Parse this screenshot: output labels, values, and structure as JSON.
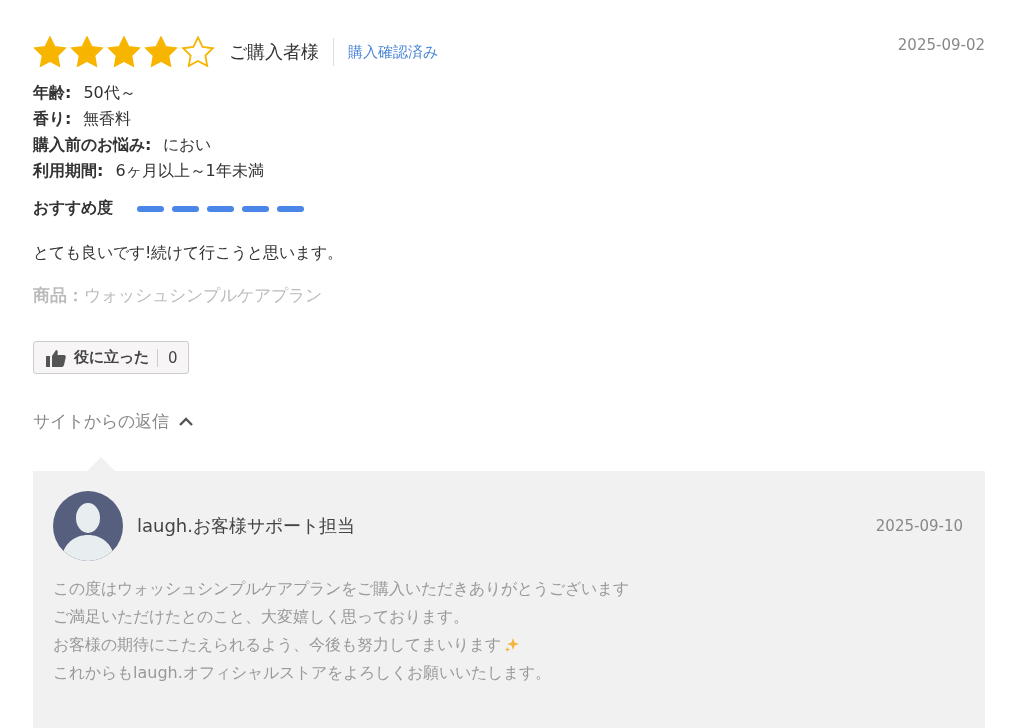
{
  "review": {
    "stars": 4,
    "author": "ご購入者様",
    "verified": "購入確認済み",
    "date": "2025-09-02",
    "attributes": [
      {
        "label": "年齢:",
        "value": "50代～"
      },
      {
        "label": "香り:",
        "value": "無香料"
      },
      {
        "label": "購入前のお悩み:",
        "value": "におい"
      },
      {
        "label": "利用期間:",
        "value": "6ヶ月以上～1年未満"
      }
    ],
    "recommend": {
      "label": "おすすめ度",
      "stars": 5
    },
    "body": "とても良いです!続けて行こうと思います。",
    "product": {
      "label": "商品：",
      "value": "ウォッシュシンプルケアプラン"
    },
    "helpful": {
      "label": "役に立った",
      "count": "0"
    }
  },
  "reply": {
    "toggle": "サイトからの返信",
    "expanded": true,
    "author": "laugh.お客様サポート担当",
    "date": "2025-09-10",
    "lines": [
      "この度はウォッシュシンプルケアプランをご購入いただきありがとうございます",
      "ご満足いただけたとのこと、大変嬉しく思っております。",
      "お客様の期待にこたえられるよう、今後も努力してまいります",
      "これからもlaugh.オフィシャルストアをよろしくお願いいたします。"
    ]
  }
}
